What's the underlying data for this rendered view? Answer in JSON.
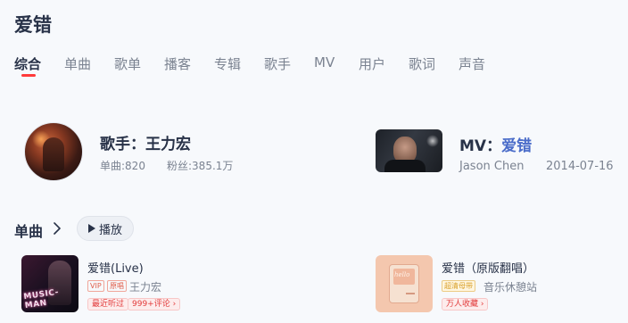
{
  "page": {
    "title": "爱错"
  },
  "tabs": [
    {
      "label": "综合",
      "active": true
    },
    {
      "label": "单曲"
    },
    {
      "label": "歌单"
    },
    {
      "label": "播客"
    },
    {
      "label": "专辑"
    },
    {
      "label": "歌手"
    },
    {
      "label": "MV"
    },
    {
      "label": "用户"
    },
    {
      "label": "歌词"
    },
    {
      "label": "声音"
    }
  ],
  "singer_card": {
    "label": "歌手：王力宏",
    "songs": "单曲:820",
    "fans": "粉丝:385.1万"
  },
  "mv_card": {
    "prefix": "MV：",
    "title": "爱错",
    "artist": "Jason Chen",
    "date": "2014-07-16"
  },
  "songs_section": {
    "title": "单曲",
    "play_label": "播放"
  },
  "songs": [
    {
      "name": "爱错(Live)",
      "tags": [
        "VIP",
        "原唱"
      ],
      "artist": "王力宏",
      "badges": [
        "最近听过",
        "999+评论"
      ],
      "cover_text": "MUSIC-MAN"
    },
    {
      "name": "爱错（原版翻唱）",
      "tags": [
        "超清母带"
      ],
      "artist": "音乐休憩站",
      "badges": [
        "万人收藏"
      ],
      "cover_text": "hello"
    }
  ],
  "colors": {
    "accent": "#ff3a3a",
    "link": "#4a6cc9",
    "text": "#283248",
    "muted": "#7b8391",
    "background": "#f7f9fc"
  }
}
